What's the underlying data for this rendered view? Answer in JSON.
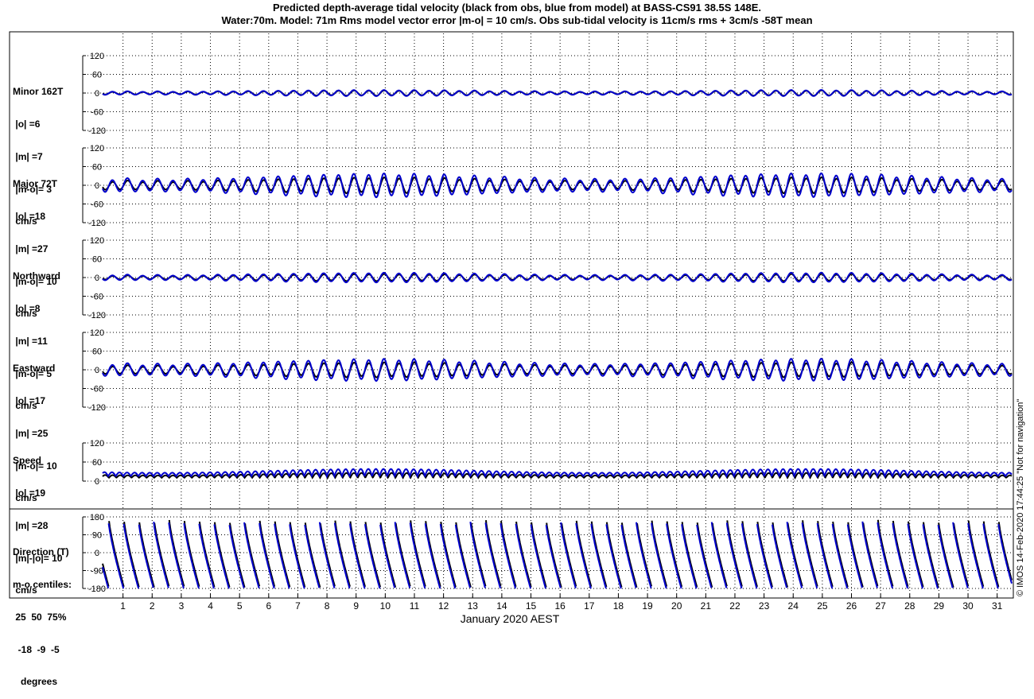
{
  "title": {
    "line1": "Predicted depth-average tidal velocity (black from obs, blue from model) at BASS-CS91 38.5S 148E.",
    "line2": "Water:70m. Model: 71m  Rms model vector error |m-o| = 10 cm/s. Obs sub-tidal velocity is 11cm/s rms + 3cm/s -58T mean"
  },
  "xlabel": "January 2020 AEST",
  "credit": "© IMOS 14-Feb-2020 17:44:25  \"Not for navigation\"",
  "colors": {
    "obs": "#000000",
    "model": "#0000cc",
    "grid": "#000000",
    "background": "#ffffff"
  },
  "panels": [
    {
      "id": "minor",
      "lines": [
        "Minor 162T",
        " |o| =6",
        " |m| =7",
        " |m-o|= 3",
        " cm/s"
      ]
    },
    {
      "id": "major",
      "lines": [
        "Major 72T",
        " |o| =18",
        " |m| =27",
        " |m-o|= 10",
        " cm/s"
      ]
    },
    {
      "id": "north",
      "lines": [
        "Northward",
        " |o| =8",
        " |m| =11",
        " |m-o|= 5",
        " cm/s"
      ]
    },
    {
      "id": "east",
      "lines": [
        "Eastward",
        " |o| =17",
        " |m| =25",
        " |m-o|= 10",
        " cm/s"
      ]
    },
    {
      "id": "speed",
      "lines": [
        "Speed",
        " |o| =19",
        " |m| =28",
        " |m|-|o|= 10",
        " cm/s"
      ]
    },
    {
      "id": "direction",
      "lines": [
        "Direction (T)",
        "m-o centiles:",
        " 25  50  75%",
        "  -18  -9  -5",
        "   degrees"
      ]
    }
  ],
  "chart_data": {
    "type": "line",
    "x_unit": "day of January 2020",
    "xlim": [
      0.3,
      31.5
    ],
    "x_ticks": [
      1,
      2,
      3,
      4,
      5,
      6,
      7,
      8,
      9,
      10,
      11,
      12,
      13,
      14,
      15,
      16,
      17,
      18,
      19,
      20,
      21,
      22,
      23,
      24,
      25,
      26,
      27,
      28,
      29,
      30,
      31
    ],
    "xlabel": "January 2020 AEST",
    "subplots": [
      {
        "name": "Minor 162T",
        "ylim": [
          -120,
          120
        ],
        "yticks": [
          -120,
          -60,
          0,
          60,
          120
        ],
        "series": [
          {
            "role": "obs",
            "amplitude": 6
          },
          {
            "role": "model",
            "amplitude": 7
          }
        ]
      },
      {
        "name": "Major 72T",
        "ylim": [
          -120,
          120
        ],
        "yticks": [
          -120,
          -60,
          0,
          60,
          120
        ],
        "series": [
          {
            "role": "obs",
            "amplitude": 18
          },
          {
            "role": "model",
            "amplitude": 27
          }
        ]
      },
      {
        "name": "Northward",
        "ylim": [
          -120,
          120
        ],
        "yticks": [
          -120,
          -60,
          0,
          60,
          120
        ],
        "series": [
          {
            "role": "obs",
            "amplitude": 8
          },
          {
            "role": "model",
            "amplitude": 11
          }
        ]
      },
      {
        "name": "Eastward",
        "ylim": [
          -120,
          120
        ],
        "yticks": [
          -120,
          -60,
          0,
          60,
          120
        ],
        "series": [
          {
            "role": "obs",
            "amplitude": 17
          },
          {
            "role": "model",
            "amplitude": 25
          }
        ]
      },
      {
        "name": "Speed",
        "ylim": [
          0,
          120
        ],
        "yticks": [
          0,
          60,
          120
        ],
        "series": [
          {
            "role": "obs",
            "amplitude": 19
          },
          {
            "role": "model",
            "amplitude": 28
          }
        ]
      },
      {
        "name": "Direction (T)",
        "ylim": [
          -180,
          180
        ],
        "yticks": [
          -180,
          -90,
          0,
          90,
          180
        ],
        "series": [
          {
            "role": "obs"
          },
          {
            "role": "model"
          }
        ]
      }
    ],
    "grid": true
  }
}
